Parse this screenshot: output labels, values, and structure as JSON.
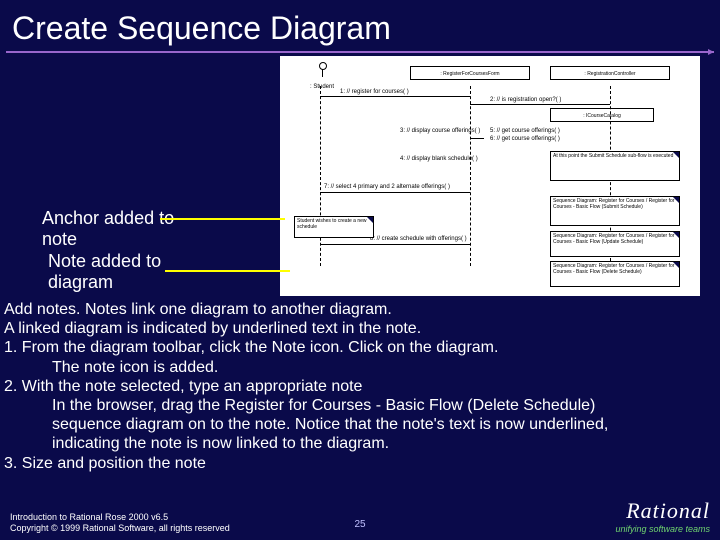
{
  "title": "Create Sequence Diagram",
  "anchor": {
    "label1": "Anchor added to note",
    "label2": "Note added to diagram"
  },
  "diagram": {
    "actor_label": ": Student",
    "box1": ": RegisterForCoursesForm",
    "box2": ": RegistrationController",
    "box3": ": ICourseCatalog",
    "msg1": "1: // register for courses( )",
    "msg2": "2: // is registration open?( )",
    "msg3": "3: // display course offerings( )",
    "msg4": "4: // display blank schedule( )",
    "msg5": "5: // get course offerings( )",
    "msg6": "6: // get course offerings( )",
    "msg7": "7: // select 4 primary and 2 alternate offerings( )",
    "msg8": "8: // create schedule with offerings( )",
    "note_localnote": "Student wishes to create a new schedule",
    "note_right1": "At this point the Submit Schedule sub-flow is executed",
    "note_right2": "Sequence Diagram: Register for Courses / Register for Courses - Basic Flow (Submit Schedule)",
    "note_right3a": "Sequence Diagram: Register for Courses / Register for Courses - Basic Flow (Update Schedule)",
    "note_right3b": "Sequence Diagram: Register for Courses / Register for Courses - Basic Flow (Delete Schedule)"
  },
  "body": {
    "l1": "Add notes.  Notes link one diagram to another diagram.",
    "l2": "A linked diagram is indicated by underlined text in the note.",
    "l3": "1.  From the diagram toolbar, click the Note icon. Click on the diagram.",
    "l3b": "The note icon is added.",
    "l4": "2.  With the note selected, type an appropriate note",
    "l4b": "In the browser, drag the Register for Courses - Basic Flow (Delete Schedule)",
    "l4c": "sequence diagram on to the note. Notice that the note's text is now underlined,",
    "l4d": "indicating the note is now linked to the diagram.",
    "l5": "3.  Size and position the note"
  },
  "footer": {
    "line1": "Introduction to Rational Rose 2000 v6.5",
    "line2": "Copyright © 1999 Rational Software, all rights reserved"
  },
  "pagenum": "25",
  "logo": {
    "brand": "Rational",
    "tag": "unifying software teams"
  }
}
